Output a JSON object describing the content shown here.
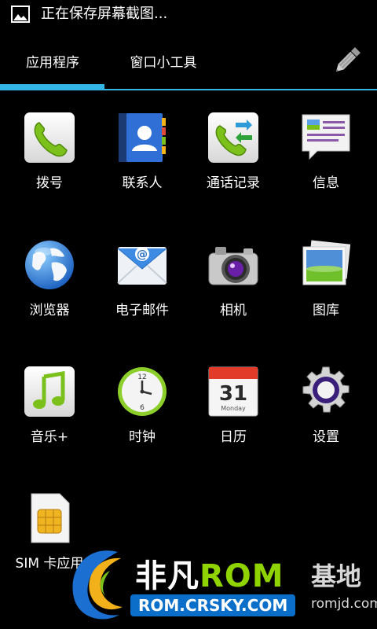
{
  "status_bar": {
    "notification_icon": "image-icon",
    "notification_text": "正在保存屏幕截图..."
  },
  "tabs": {
    "apps_label": "应用程序",
    "widgets_label": "窗口小工具",
    "selected": "应用程序",
    "edit_icon": "pencil-icon",
    "accent_color": "#33b5e5"
  },
  "apps": [
    {
      "label": "拨号",
      "icon": "phone-icon"
    },
    {
      "label": "联系人",
      "icon": "contacts-icon"
    },
    {
      "label": "通话记录",
      "icon": "call-log-icon"
    },
    {
      "label": "信息",
      "icon": "messaging-icon"
    },
    {
      "label": "浏览器",
      "icon": "globe-icon"
    },
    {
      "label": "电子邮件",
      "icon": "email-icon"
    },
    {
      "label": "相机",
      "icon": "camera-icon"
    },
    {
      "label": "图库",
      "icon": "gallery-icon"
    },
    {
      "label": "音乐+",
      "icon": "music-icon"
    },
    {
      "label": "时钟",
      "icon": "clock-icon"
    },
    {
      "label": "日历",
      "icon": "calendar-icon"
    },
    {
      "label": "设置",
      "icon": "settings-gear-icon"
    },
    {
      "label": "SIM 卡应用",
      "icon": "sim-card-icon"
    }
  ],
  "calendar_icon": {
    "day": "31",
    "weekday": "Monday"
  },
  "clock_icon": {
    "top_numeral": "12",
    "bottom_numeral": "6"
  },
  "email_icon": {
    "glyph": "@"
  },
  "watermark": {
    "brand_part1": "非凡",
    "brand_part2": "ROM",
    "site": "ROM.CRSKY.COM",
    "base_text": "基地",
    "domain_text": "romjd.com"
  }
}
